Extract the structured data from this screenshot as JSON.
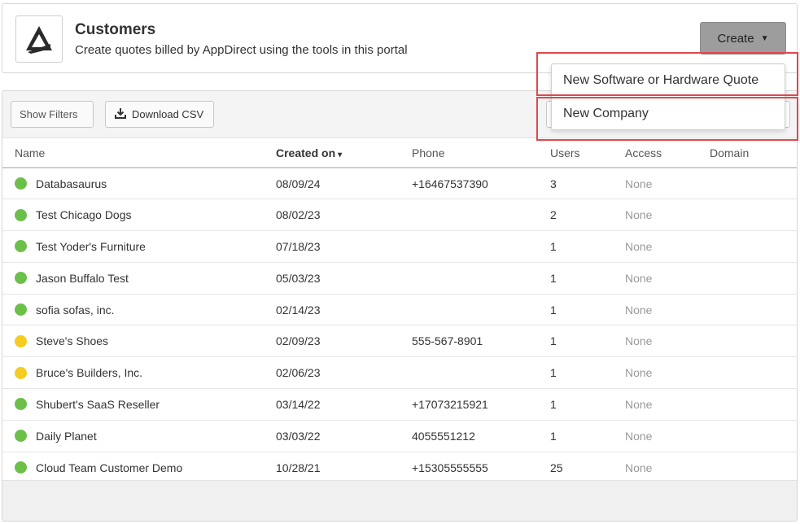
{
  "header": {
    "title": "Customers",
    "subtitle": "Create quotes billed by AppDirect using the tools in this portal",
    "logo_icon": "appdirect-logo-icon",
    "create_label": "Create",
    "create_caret": "▼"
  },
  "create_menu": {
    "items": [
      {
        "label": "New Software or Hardware Quote"
      },
      {
        "label": "New Company"
      }
    ]
  },
  "toolbar": {
    "show_filters_label": "Show Filters",
    "download_csv_label": "Download CSV",
    "download_icon": "download-icon"
  },
  "table": {
    "columns": {
      "name": "Name",
      "created": "Created on",
      "created_sort": "▾",
      "phone": "Phone",
      "users": "Users",
      "access": "Access",
      "domain": "Domain"
    },
    "rows": [
      {
        "status_color": "#6cc04a",
        "name": "Databasaurus",
        "created": "08/09/24",
        "phone": "+16467537390",
        "users": "3",
        "access": "None",
        "domain": ""
      },
      {
        "status_color": "#6cc04a",
        "name": "Test Chicago Dogs",
        "created": "08/02/23",
        "phone": "",
        "users": "2",
        "access": "None",
        "domain": ""
      },
      {
        "status_color": "#6cc04a",
        "name": "Test Yoder's Furniture",
        "created": "07/18/23",
        "phone": "",
        "users": "1",
        "access": "None",
        "domain": ""
      },
      {
        "status_color": "#6cc04a",
        "name": "Jason Buffalo Test",
        "created": "05/03/23",
        "phone": "",
        "users": "1",
        "access": "None",
        "domain": ""
      },
      {
        "status_color": "#6cc04a",
        "name": "sofia sofas, inc.",
        "created": "02/14/23",
        "phone": "",
        "users": "1",
        "access": "None",
        "domain": ""
      },
      {
        "status_color": "#f5cc1f",
        "name": "Steve's Shoes",
        "created": "02/09/23",
        "phone": "555-567-8901",
        "users": "1",
        "access": "None",
        "domain": ""
      },
      {
        "status_color": "#f5cc1f",
        "name": "Bruce's Builders, Inc.",
        "created": "02/06/23",
        "phone": "",
        "users": "1",
        "access": "None",
        "domain": ""
      },
      {
        "status_color": "#6cc04a",
        "name": "Shubert's SaaS Reseller",
        "created": "03/14/22",
        "phone": "+17073215921",
        "users": "1",
        "access": "None",
        "domain": ""
      },
      {
        "status_color": "#6cc04a",
        "name": "Daily Planet",
        "created": "03/03/22",
        "phone": "4055551212",
        "users": "1",
        "access": "None",
        "domain": ""
      },
      {
        "status_color": "#6cc04a",
        "name": "Cloud Team Customer Demo",
        "created": "10/28/21",
        "phone": "+15305555555",
        "users": "25",
        "access": "None",
        "domain": ""
      }
    ]
  },
  "highlight_color": "#e0474c"
}
